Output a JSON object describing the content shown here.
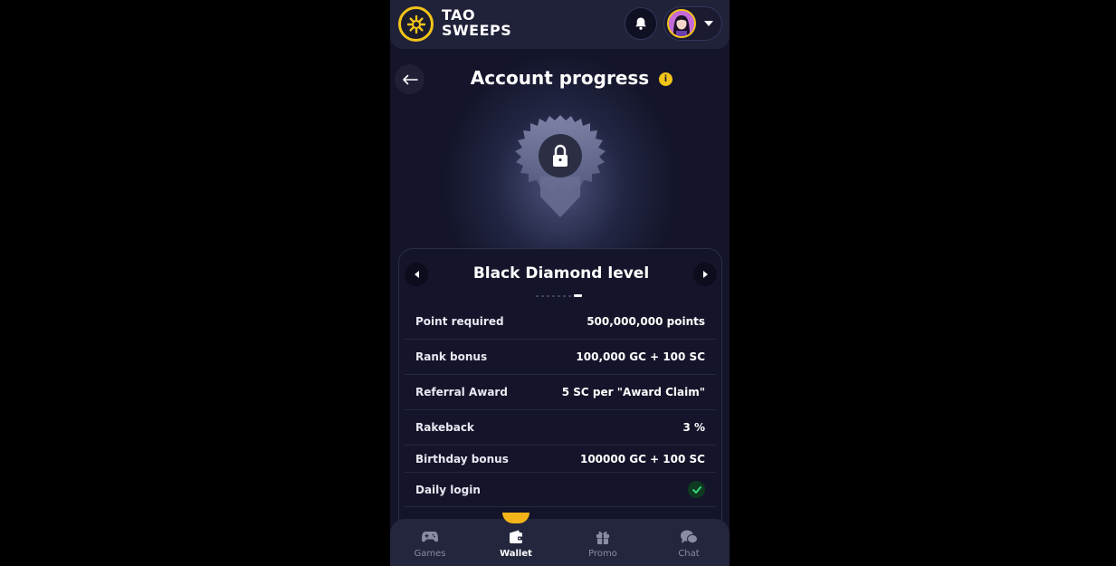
{
  "app": {
    "logo_line1": "TAO",
    "logo_line2": "SWEEPS",
    "brand_color": "#f2c418"
  },
  "page": {
    "title": "Account progress",
    "info_glyph": "i"
  },
  "level": {
    "name": "Black Diamond level",
    "total_levels": 8,
    "current_index": 8,
    "locked": true,
    "rows": [
      {
        "label": "Point required",
        "value": "500,000,000 points"
      },
      {
        "label": "Rank bonus",
        "value": "100,000 GC + 100 SC"
      },
      {
        "label": "Referral Award",
        "value": "5 SC per \"Award Claim\""
      },
      {
        "label": "Rakeback",
        "value": "3 %"
      },
      {
        "label": "Birthday bonus",
        "value": "100000 GC + 100 SC"
      },
      {
        "label": "Daily login",
        "value": "",
        "status": "check"
      }
    ]
  },
  "bottom_nav": {
    "items": [
      {
        "label": "Games",
        "icon": "gamepad-icon"
      },
      {
        "label": "Wallet",
        "icon": "wallet-icon",
        "active": true
      },
      {
        "label": "Promo",
        "icon": "gift-icon"
      },
      {
        "label": "Chat",
        "icon": "chat-icon"
      }
    ]
  }
}
